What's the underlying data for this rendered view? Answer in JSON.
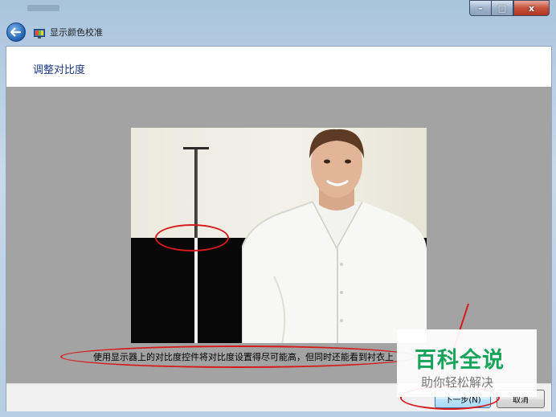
{
  "window": {
    "app_title": "显示颜色校准",
    "caption": {
      "minimize": "–",
      "maximize": "□",
      "close": "x"
    }
  },
  "page": {
    "title": "调整对比度"
  },
  "instruction": "使用显示器上的对比度控件将对比度设置得尽可能高，但同时还能看到衬衣上",
  "buttons": {
    "next": "下一步(N)",
    "cancel": "取消"
  },
  "watermark": {
    "main": "百科全说",
    "sub": "助你轻松解决"
  },
  "colors": {
    "accent": "#1e3a8a",
    "annotation": "#d61a1a",
    "watermark": "#18a45a"
  }
}
